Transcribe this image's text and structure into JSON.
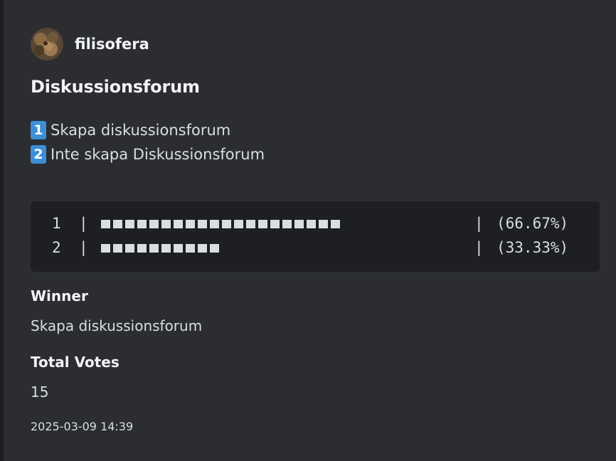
{
  "embed": {
    "author": {
      "name": "filisofera"
    },
    "title": "Diskussionsforum",
    "options": [
      {
        "key": "1",
        "label": "Skapa diskussionsforum"
      },
      {
        "key": "2",
        "label": "Inte skapa Diskussionsforum"
      }
    ],
    "results": [
      {
        "num": "1",
        "sep": "|",
        "blocks": 20,
        "sep2": "|",
        "percent": "(66.67%)",
        "fraction": 0.6667
      },
      {
        "num": "2",
        "sep": "|",
        "blocks": 10,
        "sep2": "|",
        "percent": "(33.33%)",
        "fraction": 0.3333
      }
    ],
    "fields": [
      {
        "name": "Winner",
        "value": "Skapa diskussionsforum"
      },
      {
        "name": "Total Votes",
        "value": "15"
      }
    ],
    "timestamp": "2025-03-09 14:39"
  },
  "colors": {
    "embed_bg": "#2b2d31",
    "codeblock_bg": "#1e1f22",
    "keycap": "#3d8fd6",
    "text_primary": "#f2f3f5",
    "text_secondary": "#dbdee1"
  },
  "icons": {
    "avatar": "avatar-image",
    "keycap_1": "keycap-one-icon",
    "keycap_2": "keycap-two-icon"
  }
}
